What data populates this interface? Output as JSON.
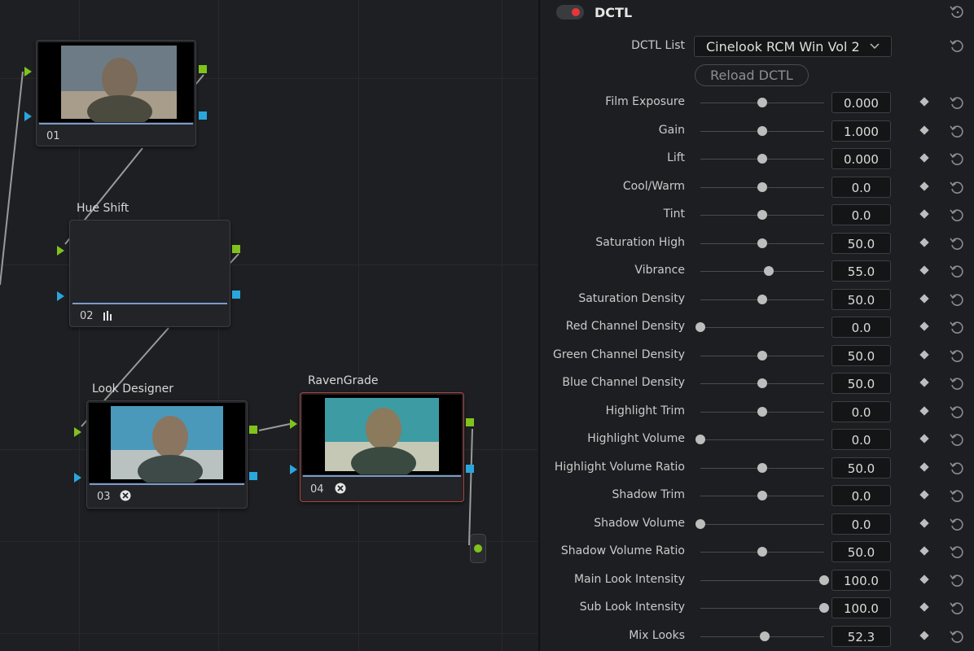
{
  "graph": {
    "nodes": [
      {
        "id": "01",
        "title": "",
        "number": "01"
      },
      {
        "id": "02",
        "title": "Hue Shift",
        "number": "02"
      },
      {
        "id": "03",
        "title": "Look Designer",
        "number": "03"
      },
      {
        "id": "04",
        "title": "RavenGrade",
        "number": "04"
      }
    ]
  },
  "panel": {
    "title": "DCTL",
    "dctl_list_label": "DCTL List",
    "dctl_list_value": "Cinelook RCM Win Vol 2",
    "reload_label": "Reload DCTL",
    "params": [
      {
        "label": "Film Exposure",
        "value": "0.000",
        "pos": 0.5
      },
      {
        "label": "Gain",
        "value": "1.000",
        "pos": 0.5
      },
      {
        "label": "Lift",
        "value": "0.000",
        "pos": 0.5
      },
      {
        "label": "Cool/Warm",
        "value": "0.0",
        "pos": 0.5
      },
      {
        "label": "Tint",
        "value": "0.0",
        "pos": 0.5
      },
      {
        "label": "Saturation High",
        "value": "50.0",
        "pos": 0.5
      },
      {
        "label": "Vibrance",
        "value": "55.0",
        "pos": 0.55
      },
      {
        "label": "Saturation Density",
        "value": "50.0",
        "pos": 0.5
      },
      {
        "label": "Red Channel Density",
        "value": "0.0",
        "pos": 0.0
      },
      {
        "label": "Green Channel Density",
        "value": "50.0",
        "pos": 0.5
      },
      {
        "label": "Blue Channel Density",
        "value": "50.0",
        "pos": 0.5
      },
      {
        "label": "Highlight Trim",
        "value": "0.0",
        "pos": 0.5
      },
      {
        "label": "Highlight Volume",
        "value": "0.0",
        "pos": 0.0
      },
      {
        "label": "Highlight Volume Ratio",
        "value": "50.0",
        "pos": 0.5
      },
      {
        "label": "Shadow Trim",
        "value": "0.0",
        "pos": 0.5
      },
      {
        "label": "Shadow Volume",
        "value": "0.0",
        "pos": 0.0
      },
      {
        "label": "Shadow Volume Ratio",
        "value": "50.0",
        "pos": 0.5
      },
      {
        "label": "Main Look Intensity",
        "value": "100.0",
        "pos": 1.0
      },
      {
        "label": "Sub Look Intensity",
        "value": "100.0",
        "pos": 1.0
      },
      {
        "label": "Mix Looks",
        "value": "52.3",
        "pos": 0.523
      }
    ]
  },
  "colors": {
    "toggle_on": "#e6363b",
    "port_green": "#7fc31c",
    "port_blue": "#2aa6dd",
    "selected_border": "#b0413b"
  }
}
